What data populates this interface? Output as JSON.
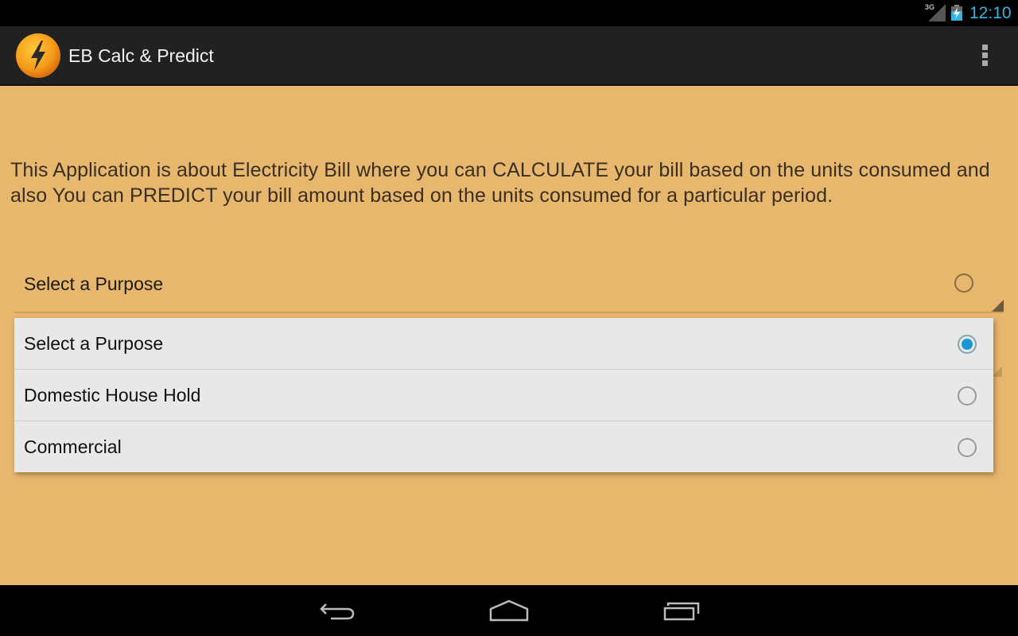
{
  "status_bar": {
    "network_label": "3G",
    "time": "12:10",
    "icons": [
      "signal-icon",
      "battery-charging-icon"
    ]
  },
  "action_bar": {
    "title": "EB Calc & Predict",
    "app_icon": "lightning-bolt-icon",
    "overflow_icon": "overflow-menu-icon"
  },
  "content": {
    "intro_text": "This Application is about Electricity Bill where you can CALCULATE your bill based on the units consumed and also You can PREDICT your bill amount based on the units consumed for a particular period.",
    "purpose_spinner": {
      "selected_label": "Select a Purpose"
    },
    "purpose_dropdown": {
      "options": [
        {
          "label": "Select a Purpose",
          "checked": true
        },
        {
          "label": "Domestic House Hold",
          "checked": false
        },
        {
          "label": "Commercial",
          "checked": false
        }
      ]
    }
  },
  "nav_bar": {
    "buttons": [
      "back",
      "home",
      "recent-apps"
    ]
  },
  "colors": {
    "background": "#e8b76e",
    "action_bar": "#212121",
    "accent_blue": "#33b5e5",
    "radio_checked": "#1a98d5",
    "dropdown_bg": "#e8e8e8"
  }
}
